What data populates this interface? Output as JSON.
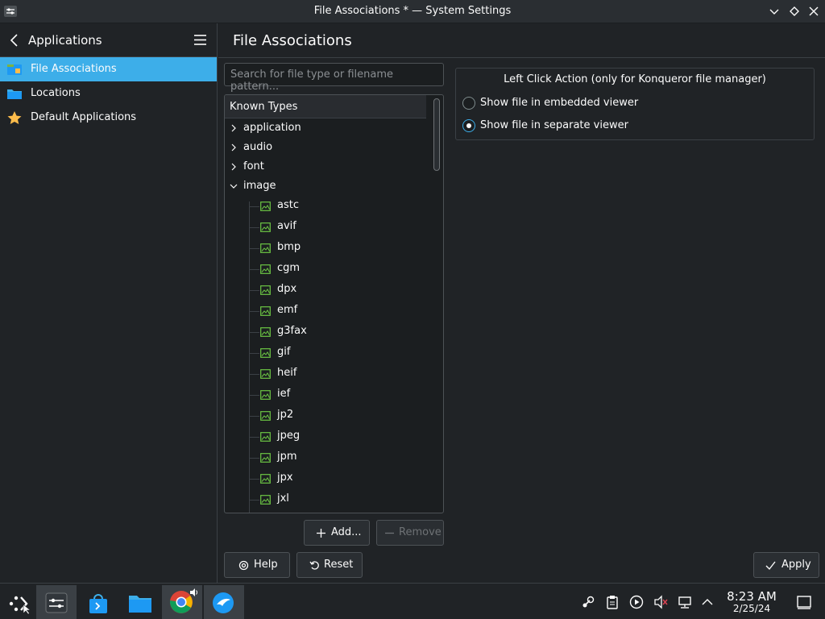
{
  "window": {
    "title": "File Associations * — System Settings"
  },
  "sidebar": {
    "back_label": "Applications",
    "items": [
      {
        "label": "File Associations",
        "icon": "file-associations-icon",
        "active": true
      },
      {
        "label": "Locations",
        "icon": "folder-icon",
        "active": false
      },
      {
        "label": "Default Applications",
        "icon": "star-icon",
        "active": false
      }
    ]
  },
  "page": {
    "title": "File Associations"
  },
  "search": {
    "placeholder": "Search for file type or filename pattern..."
  },
  "tree": {
    "header": "Known Types",
    "groups": [
      "application",
      "audio",
      "font",
      "image"
    ],
    "image_children": [
      "astc",
      "avif",
      "bmp",
      "cgm",
      "dpx",
      "emf",
      "g3fax",
      "gif",
      "heif",
      "ief",
      "jp2",
      "jpeg",
      "jpm",
      "jpx",
      "jxl"
    ]
  },
  "buttons": {
    "add": "Add...",
    "remove": "Remove",
    "help": "Help",
    "reset": "Reset",
    "apply": "Apply"
  },
  "left_click": {
    "title": "Left Click Action (only for Konqueror file manager)",
    "options": [
      {
        "label": "Show file in embedded viewer",
        "selected": false
      },
      {
        "label": "Show file in separate viewer",
        "selected": true
      }
    ]
  },
  "taskbar": {
    "time": "8:23 AM",
    "date": "2/25/24"
  },
  "colors": {
    "accent": "#3daee9",
    "background": "#202326",
    "panel": "#1b1e20"
  }
}
